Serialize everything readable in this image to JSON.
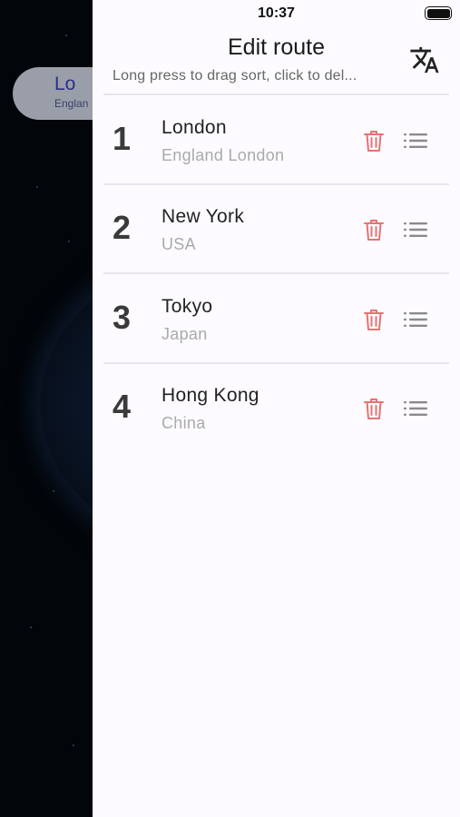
{
  "status_bar": {
    "time": "10:37"
  },
  "background": {
    "location_pill": {
      "name": "Lo",
      "subtitle": "Englan"
    }
  },
  "header": {
    "title": "Edit route",
    "subtitle": "Long press to drag sort, click to del...",
    "translate_icon": "translate-icon"
  },
  "route": [
    {
      "index": "1",
      "city": "London",
      "country": "England London"
    },
    {
      "index": "2",
      "city": "New York",
      "country": "USA"
    },
    {
      "index": "3",
      "city": "Tokyo",
      "country": "Japan"
    },
    {
      "index": "4",
      "city": "Hong Kong",
      "country": "China"
    }
  ],
  "colors": {
    "delete": "#e57373",
    "drag_handle": "#8a8a8e",
    "panel_bg": "#fdfbff"
  }
}
